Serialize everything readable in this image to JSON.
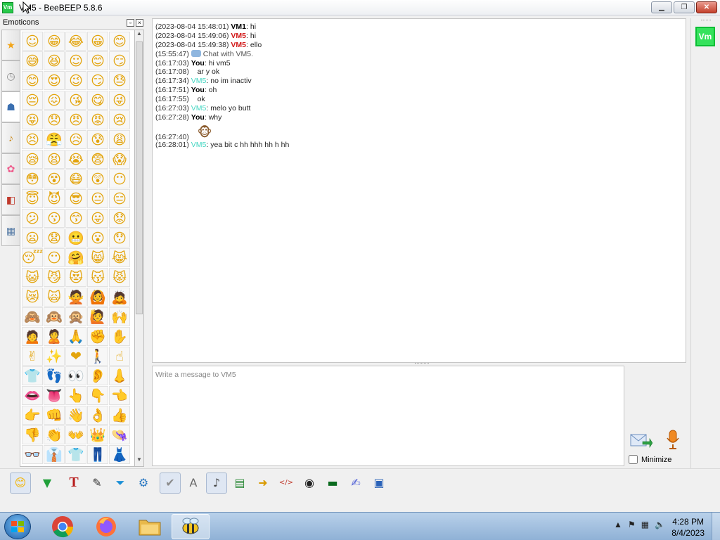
{
  "window": {
    "title": "VM5 - BeeBEEP 5.8.6",
    "app_icon": "Vm"
  },
  "emoticons": {
    "title": "Emoticons",
    "tabs": [
      "star-icon",
      "clock-icon",
      "people-icon",
      "bell-icon",
      "flower-icon",
      "car-icon",
      "symbols-icon"
    ],
    "glyphs": [
      "☺",
      "😁",
      "😂",
      "😀",
      "😊",
      "😅",
      "😆",
      "☺",
      "😊",
      "😏",
      "😊",
      "😍",
      "😉",
      "😏",
      "😓",
      "😔",
      "😖",
      "😘",
      "😋",
      "😜",
      "😝",
      "😞",
      "😠",
      "😡",
      "😢",
      "😣",
      "😤",
      "😥",
      "😰",
      "😩",
      "😪",
      "😫",
      "😭",
      "😨",
      "😱",
      "😳",
      "😵",
      "😷",
      "😲",
      "😶",
      "😇",
      "😈",
      "😎",
      "😐",
      "😑",
      "😕",
      "😗",
      "😙",
      "😛",
      "😟",
      "😦",
      "😧",
      "😬",
      "😮",
      "😯",
      "😴",
      "😶",
      "🤗",
      "😸",
      "😹",
      "😺",
      "😼",
      "😻",
      "😽",
      "😾",
      "😿",
      "🙀",
      "🙅",
      "🙆",
      "🙇",
      "🙈",
      "🙉",
      "🙊",
      "🙋",
      "🙌",
      "🙍",
      "🙎",
      "🙏",
      "✊",
      "✋",
      "✌",
      "✨",
      "❤",
      "🚶",
      "☝",
      "👕",
      "👣",
      "👀",
      "👂",
      "👃",
      "👄",
      "👅",
      "👆",
      "👇",
      "👈",
      "👉",
      "👊",
      "👋",
      "👌",
      "👍",
      "👎",
      "👏",
      "👐",
      "👑",
      "👒",
      "👓",
      "👔",
      "👕",
      "👖",
      "👗"
    ]
  },
  "chat": {
    "messages": [
      {
        "ts": "(2023-08-04 15:48:01)",
        "sender": "VM1",
        "sender_class": "me",
        "text": ": hi"
      },
      {
        "ts": "(2023-08-04 15:49:06)",
        "sender": "VM5",
        "sender_class": "vm5red",
        "text": ": hi"
      },
      {
        "ts": "(2023-08-04 15:49:38)",
        "sender": "VM5",
        "sender_class": "vm5red",
        "text": ": ello"
      },
      {
        "ts": "(15:55:47)",
        "sender": "",
        "sender_class": "system",
        "text": "Chat with VM5.",
        "system": true
      },
      {
        "ts": "(16:17:03)",
        "sender": "You",
        "sender_class": "me",
        "text": ": hi vm5"
      },
      {
        "ts": "(16:17:08)",
        "sender": "",
        "sender_class": "me",
        "text": "ar y ok"
      },
      {
        "ts": "(16:17:34)",
        "sender": "VM5",
        "sender_class": "vm5",
        "text": ": no im inactiv"
      },
      {
        "ts": "(16:17:51)",
        "sender": "You",
        "sender_class": "me",
        "text": ": oh"
      },
      {
        "ts": "(16:17:55)",
        "sender": "",
        "sender_class": "me",
        "text": "ok"
      },
      {
        "ts": "(16:27:03)",
        "sender": "VM5",
        "sender_class": "vm5",
        "text": ": melo yo butt"
      },
      {
        "ts": "(16:27:28)",
        "sender": "You",
        "sender_class": "me",
        "text": ": why"
      },
      {
        "ts": "(16:27:40)",
        "sender": "",
        "sender_class": "me",
        "text": "🐵",
        "emoji": true
      },
      {
        "ts": "(16:28:01)",
        "sender": "VM5",
        "sender_class": "vm5",
        "text": ": yea bit c hh hhh hh h hh"
      }
    ]
  },
  "composer": {
    "placeholder": "Write a message to VM5",
    "value": ""
  },
  "minimize": {
    "label": "Minimize",
    "checked": false
  },
  "user_panel": {
    "avatar": "Vm"
  },
  "toolbar": {
    "buttons": [
      {
        "name": "emoticons-toggle-button",
        "glyph": "😊",
        "color": "#f4b400",
        "active": true
      },
      {
        "name": "send-file-button",
        "glyph": "▼",
        "color": "#21a03a"
      },
      {
        "name": "font-button",
        "glyph": "T",
        "color": "#b71c1c"
      },
      {
        "name": "font-color-button",
        "glyph": "✎",
        "color": "#333333"
      },
      {
        "name": "filter-button",
        "glyph": "⏷",
        "color": "#1a8fd6"
      },
      {
        "name": "settings-button",
        "glyph": "⚙",
        "color": "#2a78c2"
      },
      {
        "name": "spellcheck-button",
        "glyph": "✔",
        "color": "#8d8d8d",
        "active": true
      },
      {
        "name": "text-size-button",
        "glyph": "A",
        "color": "#666666"
      },
      {
        "name": "music-button",
        "glyph": "♪",
        "color": "#444444",
        "active": true
      },
      {
        "name": "save-chat-button",
        "glyph": "▤",
        "color": "#2e8b3a"
      },
      {
        "name": "open-folder-button",
        "glyph": "➜",
        "color": "#d99a00"
      },
      {
        "name": "code-button",
        "glyph": "</>",
        "color": "#c0392b"
      },
      {
        "name": "webcam-button",
        "glyph": "◉",
        "color": "#222222"
      },
      {
        "name": "screenshot-button",
        "glyph": "▬",
        "color": "#0b6b1f"
      },
      {
        "name": "edit-button",
        "glyph": "✍",
        "color": "#4f5fd6"
      },
      {
        "name": "save-button",
        "glyph": "▣",
        "color": "#2a62b8"
      }
    ]
  },
  "taskbar": {
    "clock_time": "4:28 PM",
    "clock_date": "8/4/2023"
  }
}
